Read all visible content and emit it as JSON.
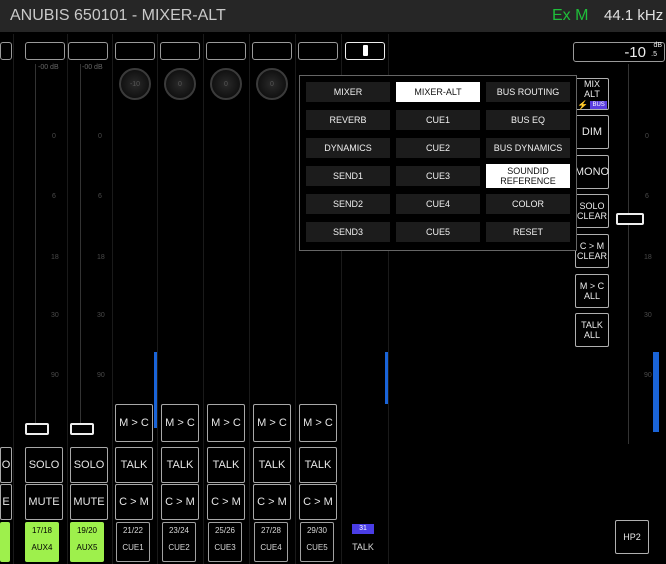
{
  "title": "ANUBIS 650101 - MIXER-ALT",
  "status": {
    "mode": "Ex M",
    "sample_rate": "44.1 kHz"
  },
  "volume": {
    "value": "-10",
    "unit": "dB",
    "fraction": ".5"
  },
  "menu": {
    "items": [
      {
        "label": "MIXER"
      },
      {
        "label": "MIXER-ALT"
      },
      {
        "label": "BUS ROUTING"
      },
      {
        "label": "REVERB"
      },
      {
        "label": "CUE1"
      },
      {
        "label": "BUS EQ"
      },
      {
        "label": "DYNAMICS"
      },
      {
        "label": "CUE2"
      },
      {
        "label": "BUS DYNAMICS"
      },
      {
        "label": "SEND1"
      },
      {
        "label": "CUE3"
      },
      {
        "label": "SOUNDID REFERENCE"
      },
      {
        "label": "SEND2"
      },
      {
        "label": "CUE4"
      },
      {
        "label": "COLOR"
      },
      {
        "label": "SEND3"
      },
      {
        "label": "CUE5"
      },
      {
        "label": "RESET"
      }
    ],
    "selected": "MIXER-ALT"
  },
  "right_panel": {
    "mix_alt": "MIX ALT",
    "mix_alt_badge": "BUS",
    "dim": "DIM",
    "mono": "MONO",
    "solo_clear": "SOLO CLEAR",
    "cm_clear": "C > M CLEAR",
    "mc_all": "M > C ALL",
    "talk_all": "TALK ALL",
    "hp2": "HP2"
  },
  "channels": {
    "aux": [
      {
        "num": "17/18",
        "name": "AUX4",
        "solo": "SOLO",
        "mute": "MUTE",
        "db": "-00 dB"
      },
      {
        "num": "19/20",
        "name": "AUX5",
        "solo": "SOLO",
        "mute": "MUTE",
        "db": "-00 dB"
      }
    ],
    "cue": [
      {
        "num": "21/22",
        "name": "CUE1",
        "mc": "M > C",
        "talk": "TALK",
        "cm": "C > M",
        "knob": "-10"
      },
      {
        "num": "23/24",
        "name": "CUE2",
        "mc": "M > C",
        "talk": "TALK",
        "cm": "C > M",
        "knob": "0"
      },
      {
        "num": "25/26",
        "name": "CUE3",
        "mc": "M > C",
        "talk": "TALK",
        "cm": "C > M",
        "knob": "0"
      },
      {
        "num": "27/28",
        "name": "CUE4",
        "mc": "M > C",
        "talk": "TALK",
        "cm": "C > M",
        "knob": "0"
      },
      {
        "num": "29/30",
        "name": "CUE5",
        "mc": "M > C",
        "talk": "TALK",
        "cm": "C > M",
        "knob": "0"
      }
    ],
    "talk": {
      "num": "31",
      "name": "TALK"
    }
  },
  "partial_labels": {
    "solo_left": "O",
    "mute_left": "E"
  },
  "scale": [
    "0",
    "6",
    "18",
    "30",
    "90",
    "oo"
  ],
  "colors": {
    "accent_green": "#9ef04c",
    "meter_blue": "#1a64d8",
    "status_green": "#1fbf3a",
    "badge_purple": "#5a3de0"
  }
}
